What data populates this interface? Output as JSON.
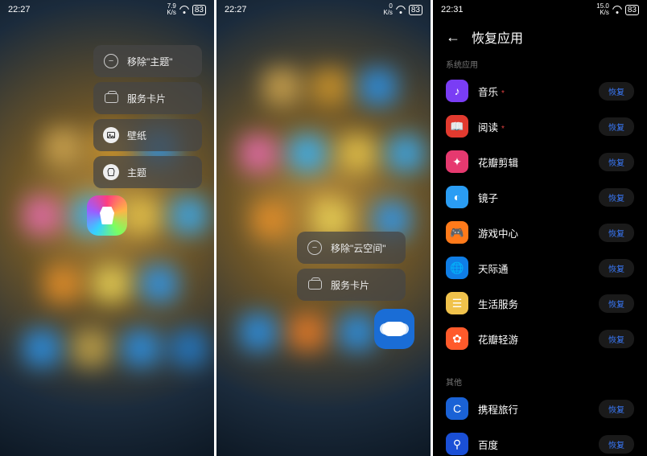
{
  "panel1": {
    "status": {
      "time": "22:27",
      "speed_top": "7.9",
      "speed_unit": "K/s",
      "battery": "83"
    },
    "menu": [
      {
        "label": "移除\"主题\"",
        "icon": "remove"
      },
      {
        "label": "服务卡片",
        "icon": "card"
      },
      {
        "label": "壁纸",
        "icon": "wallpaper"
      },
      {
        "label": "主题",
        "icon": "theme"
      }
    ]
  },
  "panel2": {
    "status": {
      "time": "22:27",
      "speed_top": "0",
      "speed_unit": "K/s",
      "battery": "83"
    },
    "menu": [
      {
        "label": "移除\"云空间\"",
        "icon": "remove"
      },
      {
        "label": "服务卡片",
        "icon": "card"
      }
    ]
  },
  "panel3": {
    "status": {
      "time": "22:31",
      "speed_top": "15.0",
      "speed_unit": "K/s",
      "battery": "83"
    },
    "title": "恢复应用",
    "section_system": "系统应用",
    "section_other": "其他",
    "restore_label": "恢复",
    "apps_system": [
      {
        "name": "音乐",
        "star": true,
        "bg": "#7a3df5",
        "glyph": "♪"
      },
      {
        "name": "阅读",
        "star": true,
        "bg": "#e23a2f",
        "glyph": "📖"
      },
      {
        "name": "花瓣剪辑",
        "star": false,
        "bg": "#e6396f",
        "glyph": "✦"
      },
      {
        "name": "镜子",
        "star": false,
        "bg": "#2a9df4",
        "glyph": "◐"
      },
      {
        "name": "游戏中心",
        "star": false,
        "bg": "#ff7a1a",
        "glyph": "🎮"
      },
      {
        "name": "天际通",
        "star": false,
        "bg": "#0f7ee6",
        "glyph": "🌐"
      },
      {
        "name": "生活服务",
        "star": false,
        "bg": "#f0c24b",
        "glyph": "☰"
      },
      {
        "name": "花瓣轻游",
        "star": false,
        "bg": "#ff5a2b",
        "glyph": "✿"
      }
    ],
    "apps_other": [
      {
        "name": "携程旅行",
        "bg": "#1a62d6",
        "glyph": "C"
      },
      {
        "name": "百度",
        "bg": "#1a4fd6",
        "glyph": "⚲"
      }
    ]
  }
}
